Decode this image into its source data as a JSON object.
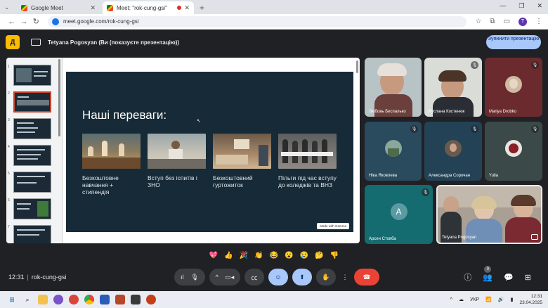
{
  "browser": {
    "tabs": [
      {
        "title": "Google Meet",
        "active": false
      },
      {
        "title": "Meet: \"rok-cung-gsi\"",
        "active": true
      }
    ],
    "new_tab": "+",
    "url": "meet.google.com/rok-cung-gsi",
    "profile_initial": "T",
    "window_controls": [
      "—",
      "❐",
      "✕"
    ]
  },
  "present_bar": {
    "logo": "Д",
    "text": "Tetyana Pogosyan (Ви (показуєте презентацію))",
    "stop_button": "Зупинити презентацію"
  },
  "slide": {
    "title": "Наші переваги:",
    "features": [
      {
        "text": "Безкоштовне навчання + стипендія"
      },
      {
        "text": "Вступ без іспитів і ЗНО"
      },
      {
        "text": "Безкоштовний гуртожиток"
      },
      {
        "text": "Пільги під час вступу до коледжів та ВНЗ"
      }
    ],
    "badge": "Made with Gamma"
  },
  "thumbnails": [
    "1",
    "2",
    "3",
    "4",
    "5",
    "6",
    "7"
  ],
  "participants": [
    {
      "name": "Любовь Беспалько",
      "muted": false
    },
    {
      "name": "Руслана Костенюк",
      "muted": true
    },
    {
      "name": "Mariya Drobko",
      "muted": true
    },
    {
      "name": "Ніка Яковлева",
      "muted": true
    },
    {
      "name": "Александра Сорочан",
      "muted": true
    },
    {
      "name": "Yulia",
      "muted": true
    },
    {
      "name": "Арсен Стовба",
      "muted": true,
      "initial": "A"
    },
    {
      "name": "Tetyana Pogosyan",
      "muted": false
    }
  ],
  "reactions": [
    "💖",
    "👍",
    "🎉",
    "👏",
    "😂",
    "😮",
    "😢",
    "🤔",
    "👎"
  ],
  "meeting": {
    "time": "12:31",
    "code": "rok-cung-gsi",
    "participant_count": "9"
  },
  "taskbar": {
    "language": "УКР",
    "time": "12:31",
    "date": "23.04.2025"
  },
  "colors": {
    "slide_bg": "#172a37",
    "stop_button": "#a8c7fa",
    "end_call": "#ea4335",
    "logo": "#fbbc04"
  }
}
